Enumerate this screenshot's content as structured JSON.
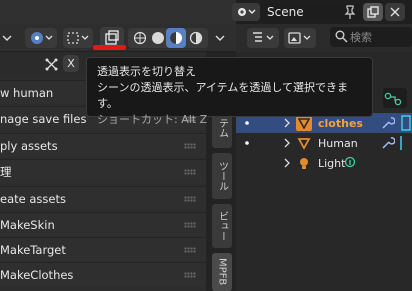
{
  "scene": {
    "name": "Scene"
  },
  "search": {
    "placeholder": "検索"
  },
  "tooltip": {
    "title": "透過表示を切り替え",
    "description": "シーンの透過表示、アイテムを透過して選択できます。",
    "shortcut": "ショートカット: Alt Z"
  },
  "panel": {
    "close_label": "X",
    "items": [
      "w human",
      "nage save files",
      "ply assets",
      "理",
      "eate assets",
      "MakeSkin",
      "MakeTarget",
      "MakeClothes"
    ]
  },
  "tabs": [
    "テム",
    "ツール",
    "ビュー",
    "MPFB"
  ],
  "outliner": {
    "rows": [
      {
        "name": "clothes",
        "selected": true
      },
      {
        "name": "Human",
        "selected": false
      },
      {
        "name": "Light",
        "selected": false
      }
    ]
  },
  "colors": {
    "accent": "#5680c2",
    "highlight_text": "#f2a33a",
    "selection_row": "#334d80",
    "red_marker": "#e01818"
  }
}
